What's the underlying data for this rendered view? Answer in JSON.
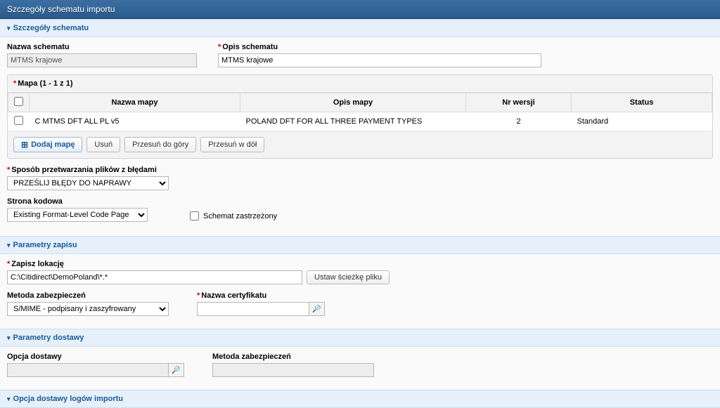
{
  "titleBar": "Szczegóły schematu importu",
  "sections": {
    "details": {
      "header": "Szczegóły schematu",
      "scheme_name_label": "Nazwa schematu",
      "scheme_name_value": "MTMS krajowe",
      "scheme_desc_label": "Opis schematu",
      "scheme_desc_value": "MTMS krajowe",
      "map_header": "Mapa (1 - 1 z 1)",
      "columns": {
        "map_name": "Nazwa mapy",
        "map_desc": "Opis mapy",
        "version": "Nr wersji",
        "status": "Status"
      },
      "rows": [
        {
          "name": "C MTMS DFT ALL PL v5",
          "desc": "POLAND DFT FOR ALL THREE PAYMENT TYPES",
          "version": "2",
          "status": "Standard"
        }
      ],
      "actions": {
        "add_map": "Dodaj mapę",
        "delete": "Usuń",
        "move_up": "Przesuń do góry",
        "move_down": "Przesuń w dół"
      },
      "error_mode_label": "Sposób przetwarzania plików z błędami",
      "error_mode_value": "PRZEŚLIJ BŁĘDY DO NAPRAWY",
      "codepage_label": "Strona kodowa",
      "codepage_value": "Existing Format-Level Code Page",
      "restricted_label": "Schemat zastrzeżony"
    },
    "save_params": {
      "header": "Parametry zapisu",
      "save_location_label": "Zapisz lokację",
      "save_location_value": "C:\\Citidirect\\DemoPoland\\*.*",
      "set_path_button": "Ustaw ścieżkę pliku",
      "security_method_label": "Metoda zabezpieczeń",
      "security_method_value": "S/MIME - podpisany i zaszyfrowany",
      "cert_label": "Nazwa certyfikatu",
      "cert_value": ""
    },
    "delivery_params": {
      "header": "Parametry dostawy",
      "delivery_option_label": "Opcja dostawy",
      "delivery_option_value": "",
      "security_method_label": "Metoda zabezpieczeń",
      "security_method_value": ""
    },
    "logs": {
      "header": "Opcja dostawy logów importu"
    }
  }
}
